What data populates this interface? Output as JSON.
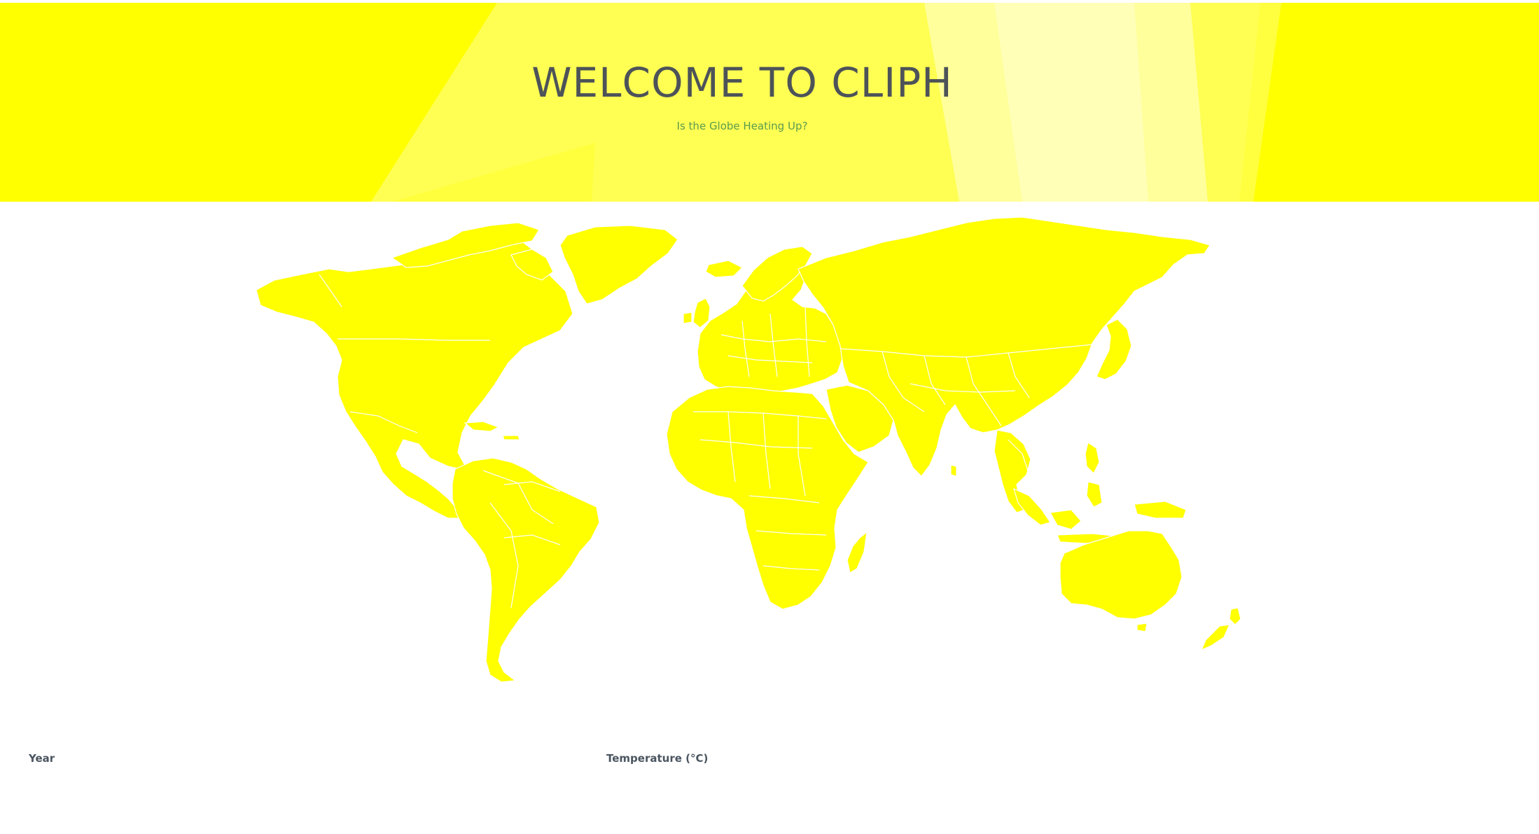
{
  "header": {
    "title": "WELCOME TO CLIPH",
    "subtitle": "Is the Globe Heating Up?"
  },
  "map": {
    "fill_color": "#ffff00",
    "border_color": "#ffffff"
  },
  "controls": {
    "year_label": "Year",
    "temperature_label": "Temperature (°C)"
  },
  "colors": {
    "hero_background": "#ffff00",
    "title_text": "#4d5358",
    "subtitle_text": "#5a9a4e",
    "label_text": "#4a5560"
  }
}
